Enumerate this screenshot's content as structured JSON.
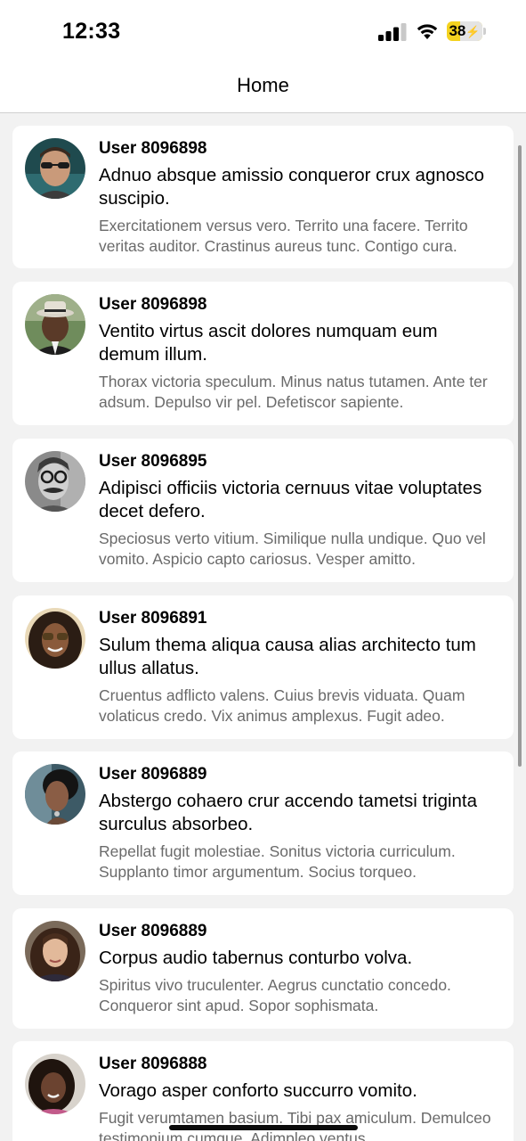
{
  "status_bar": {
    "time": "12:33",
    "battery_percent": "38",
    "battery_level": 38,
    "signal_icon": "cellular-signal-icon",
    "wifi_icon": "wifi-icon",
    "battery_icon": "battery-charging-icon"
  },
  "nav": {
    "title": "Home"
  },
  "posts": [
    {
      "user": "User 8096898",
      "title": "Adnuo absque amissio conqueror crux agnosco suscipio.",
      "body": "Exercitationem versus vero. Territo una facere. Territo veritas auditor. Crastinus aureus tunc. Contigo cura."
    },
    {
      "user": "User 8096898",
      "title": "Ventito virtus ascit dolores numquam eum demum illum.",
      "body": "Thorax victoria speculum. Minus natus tutamen. Ante ter adsum. Depulso vir pel. Defetiscor sapiente."
    },
    {
      "user": "User 8096895",
      "title": "Adipisci officiis victoria cernuus vitae voluptates decet defero.",
      "body": "Speciosus verto vitium. Similique nulla undique. Quo vel vomito. Aspicio capto cariosus. Vesper amitto."
    },
    {
      "user": "User 8096891",
      "title": "Sulum thema aliqua causa alias architecto tum ullus allatus.",
      "body": "Cruentus adflicto valens. Cuius brevis viduata. Quam volaticus credo. Vix animus amplexus. Fugit adeo."
    },
    {
      "user": "User 8096889",
      "title": "Abstergo cohaero crur accendo tametsi triginta surculus absorbeo.",
      "body": "Repellat fugit molestiae. Sonitus victoria curriculum. Supplanto timor argumentum. Socius torqueo."
    },
    {
      "user": "User 8096889",
      "title": "Corpus audio tabernus conturbo volva.",
      "body": "Spiritus vivo truculenter. Aegrus cunctatio concedo. Conqueror sint apud. Sopor sophismata."
    },
    {
      "user": "User 8096888",
      "title": "Vorago asper conforto succurro vomito.",
      "body": "Fugit verumtamen basium. Tibi pax amiculum. Demulceo testimonium cumque. Adimpleo ventus."
    }
  ]
}
